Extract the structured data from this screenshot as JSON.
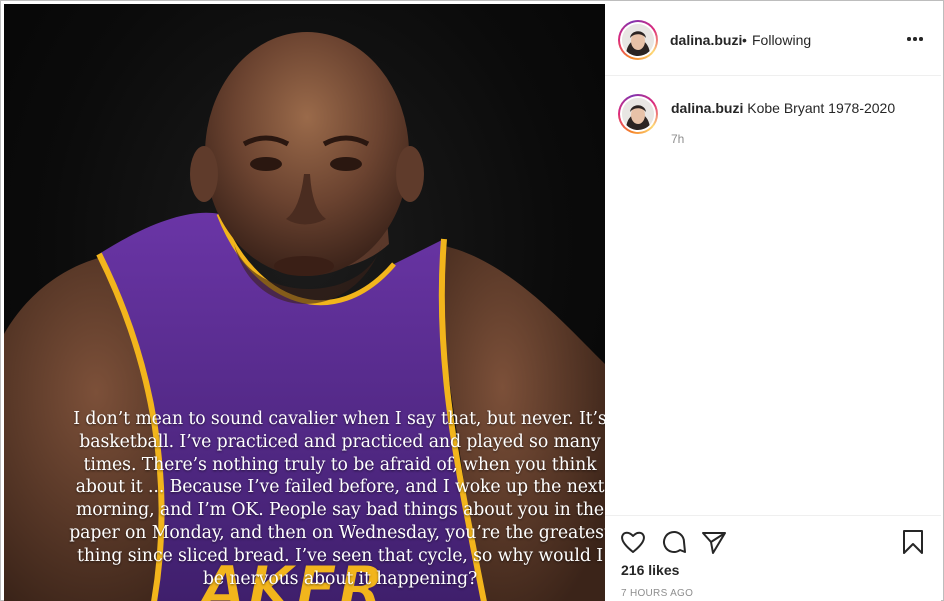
{
  "post": {
    "username": "dalina.buzi",
    "separator": "•",
    "follow_status": "Following",
    "caption": "Kobe Bryant 1978-2020",
    "caption_time": "7h",
    "likes": "216 likes",
    "posted_ago": "7 HOURS AGO"
  },
  "photo": {
    "overlay_text": "I don’t mean to sound cavalier when I say that, but never. It’s basketball. I’ve practiced and practiced and played so many times. There’s nothing truly to be afraid of, when you think about it ... Because I’ve failed before, and I woke up the next morning, and I’m OK. People say bad things about you in the paper on Monday, and then on Wednesday, you’re the greatest thing since sliced bread. I’ve seen that cycle, so why would I be nervous about it happening?",
    "jersey_text": "AKER"
  },
  "icons": {
    "like": "heart-icon",
    "comment": "comment-icon",
    "share": "paper-plane-icon",
    "save": "bookmark-icon",
    "options": "more-options-icon"
  },
  "colors": {
    "jersey_purple": "#5a2c8c",
    "jersey_gold": "#f2b51c",
    "text": "#262626",
    "muted": "#8e8e8e"
  }
}
